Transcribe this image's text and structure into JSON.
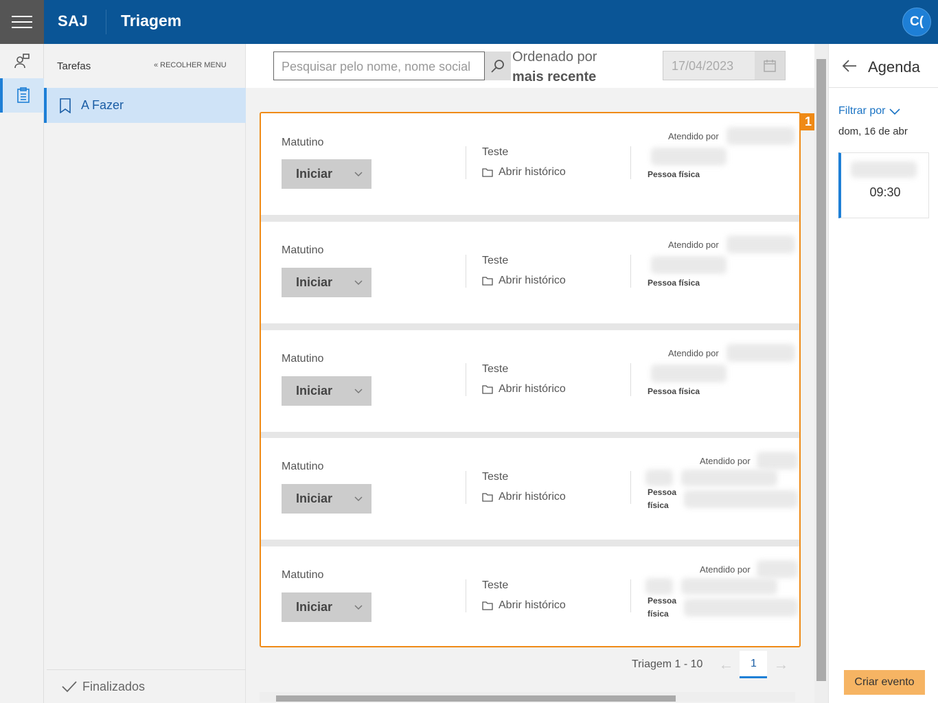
{
  "header": {
    "brand": "SAJ",
    "title": "Triagem",
    "avatar_initials": "C("
  },
  "sidebar": {
    "title": "Tarefas",
    "collapse_label": "RECOLHER MENU",
    "active_item": "A Fazer",
    "bottom_item": "Finalizados"
  },
  "toolbar": {
    "search_placeholder": "Pesquisar pelo nome, nome social",
    "sort_label": "Ordenado por",
    "sort_value": "mais recente",
    "date_value": "17/04/2023"
  },
  "list": {
    "badge": "1",
    "cards": [
      {
        "shift": "Matutino",
        "start_label": "Iniciar",
        "type": "Teste",
        "history_label": "Abrir histórico",
        "attended_label": "Atendido por",
        "person_type": "Pessoa física"
      },
      {
        "shift": "Matutino",
        "start_label": "Iniciar",
        "type": "Teste",
        "history_label": "Abrir histórico",
        "attended_label": "Atendido por",
        "person_type": "Pessoa física"
      },
      {
        "shift": "Matutino",
        "start_label": "Iniciar",
        "type": "Teste",
        "history_label": "Abrir histórico",
        "attended_label": "Atendido por",
        "person_type": "Pessoa física"
      },
      {
        "shift": "Matutino",
        "start_label": "Iniciar",
        "type": "Teste",
        "history_label": "Abrir histórico",
        "attended_label": "Atendido por",
        "person_type_line1": "Pessoa",
        "person_type_line2": "física"
      },
      {
        "shift": "Matutino",
        "start_label": "Iniciar",
        "type": "Teste",
        "history_label": "Abrir histórico",
        "attended_label": "Atendido por",
        "person_type_line1": "Pessoa",
        "person_type_line2": "física"
      }
    ]
  },
  "pagination": {
    "range": "Triagem 1 - 10",
    "current_page": "1",
    "prev_arrow": "←",
    "next_arrow": "→"
  },
  "agenda": {
    "title": "Agenda",
    "filter_label": "Filtrar por",
    "date": "dom, 16 de abr",
    "event_time": "09:30",
    "create_button": "Criar evento"
  },
  "colors": {
    "header": "#0a5596",
    "accent": "#1e7fd6",
    "highlight": "#ef8a16",
    "create_button": "#f6b463"
  }
}
